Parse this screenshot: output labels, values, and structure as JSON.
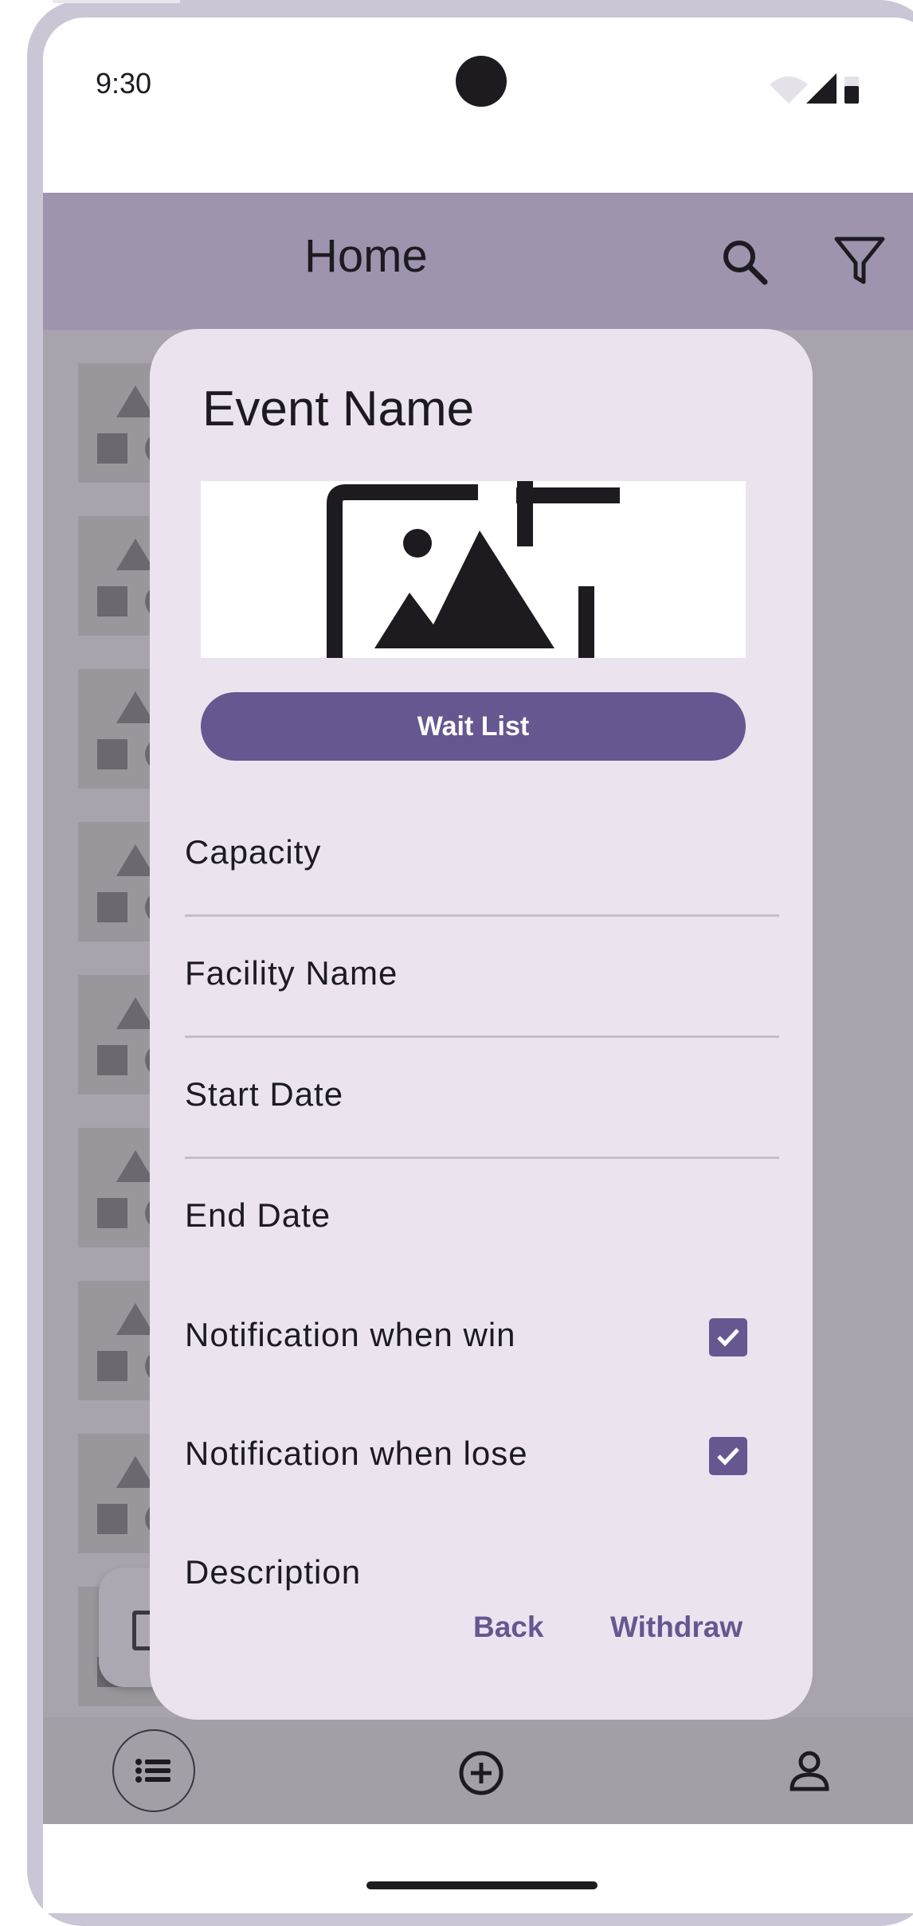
{
  "status_bar": {
    "time": "9:30"
  },
  "app_bar": {
    "title": "Home"
  },
  "dialog": {
    "title": "Event Name",
    "wait_list_label": "Wait List",
    "fields": {
      "capacity": "Capacity",
      "facility_name": "Facility Name",
      "start_date": "Start Date",
      "end_date": "End Date",
      "notify_win": "Notification when win",
      "notify_lose": "Notification when lose",
      "description": "Description"
    },
    "notify_win_checked": true,
    "notify_lose_checked": true,
    "back_label": "Back",
    "withdraw_label": "Withdraw"
  },
  "bottom_nav": {
    "items": [
      {
        "icon": "list-icon"
      },
      {
        "icon": "add-circle-icon"
      },
      {
        "icon": "person-icon"
      }
    ]
  },
  "colors": {
    "primary": "#665790",
    "app_bar": "#9e94ae",
    "dialog_surface": "#ebe4ef",
    "scrim_content": "#a8a3ad"
  }
}
